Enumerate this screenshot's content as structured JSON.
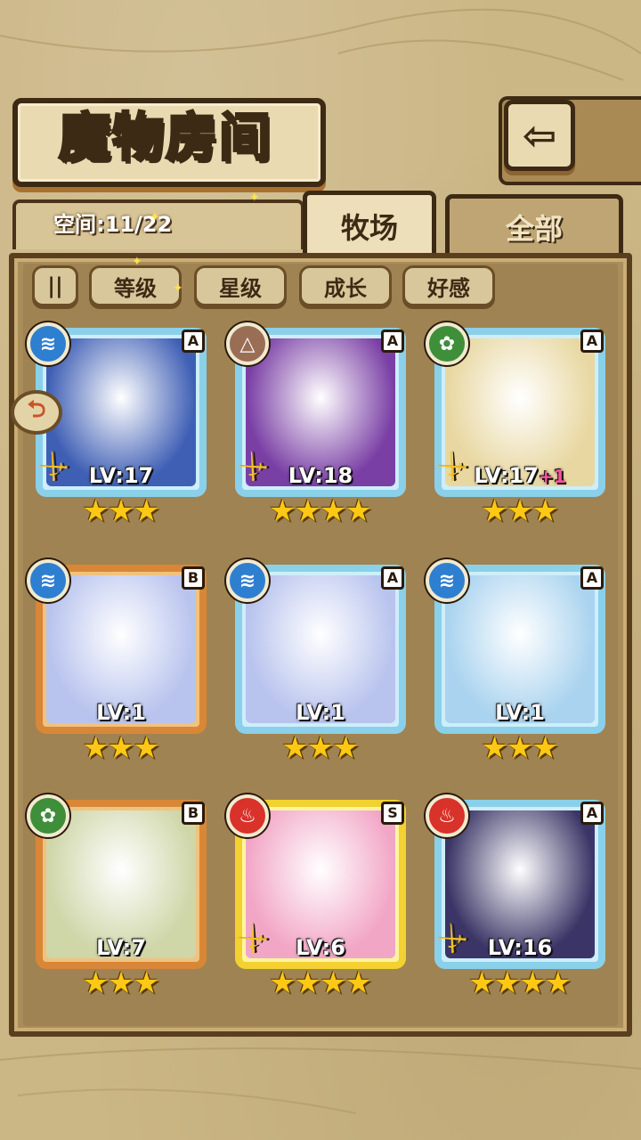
{
  "header": {
    "title": "魔物房间",
    "back_glyph": "⇦"
  },
  "space": {
    "label": "空间:11/22"
  },
  "tabs": [
    {
      "label": "牧场",
      "active": true
    },
    {
      "label": "全部",
      "active": false
    }
  ],
  "sort": {
    "toggle_glyph": "||",
    "buttons": [
      "等级",
      "星级",
      "成长",
      "好感"
    ]
  },
  "cards": [
    {
      "rank": "A",
      "element": "water",
      "element_glyph": "≋",
      "level": "LV:17",
      "bonus": "",
      "stars": 3,
      "frame": "blue",
      "has_weapon": true,
      "art_color": "#3f5fb5"
    },
    {
      "rank": "A",
      "element": "earth",
      "element_glyph": "△",
      "level": "LV:18",
      "bonus": "",
      "stars": 4,
      "frame": "blue",
      "has_weapon": true,
      "art_color": "#7a3fa5"
    },
    {
      "rank": "A",
      "element": "nature",
      "element_glyph": "✿",
      "level": "LV:17",
      "bonus": "+1",
      "stars": 3,
      "frame": "blue",
      "has_weapon": true,
      "art_color": "#e8d7a0"
    },
    {
      "rank": "B",
      "element": "water",
      "element_glyph": "≋",
      "level": "LV:1",
      "bonus": "",
      "stars": 3,
      "frame": "orange",
      "has_weapon": false,
      "art_color": "#b8c3ee"
    },
    {
      "rank": "A",
      "element": "water",
      "element_glyph": "≋",
      "level": "LV:1",
      "bonus": "",
      "stars": 3,
      "frame": "blue",
      "has_weapon": false,
      "art_color": "#b8c3ee"
    },
    {
      "rank": "A",
      "element": "water",
      "element_glyph": "≋",
      "level": "LV:1",
      "bonus": "",
      "stars": 3,
      "frame": "blue",
      "has_weapon": false,
      "art_color": "#a9d3ef"
    },
    {
      "rank": "B",
      "element": "nature",
      "element_glyph": "✿",
      "level": "LV:7",
      "bonus": "",
      "stars": 3,
      "frame": "orange",
      "has_weapon": false,
      "art_color": "#cfd6a8"
    },
    {
      "rank": "S",
      "element": "fire",
      "element_glyph": "♨",
      "level": "LV:6",
      "bonus": "",
      "stars": 4,
      "frame": "gold",
      "has_weapon": true,
      "art_color": "#f2a6c6"
    },
    {
      "rank": "A",
      "element": "fire",
      "element_glyph": "♨",
      "level": "LV:16",
      "bonus": "",
      "stars": 4,
      "frame": "blue",
      "has_weapon": true,
      "art_color": "#3a3566"
    }
  ],
  "colors": {
    "water": "#2f7fd1",
    "earth": "#9a6e55",
    "nature": "#3f8f3a",
    "fire": "#d8322a"
  },
  "side_tab_glyph": "⮌",
  "star_glyph": "★",
  "weapon_glyph": "🗡"
}
